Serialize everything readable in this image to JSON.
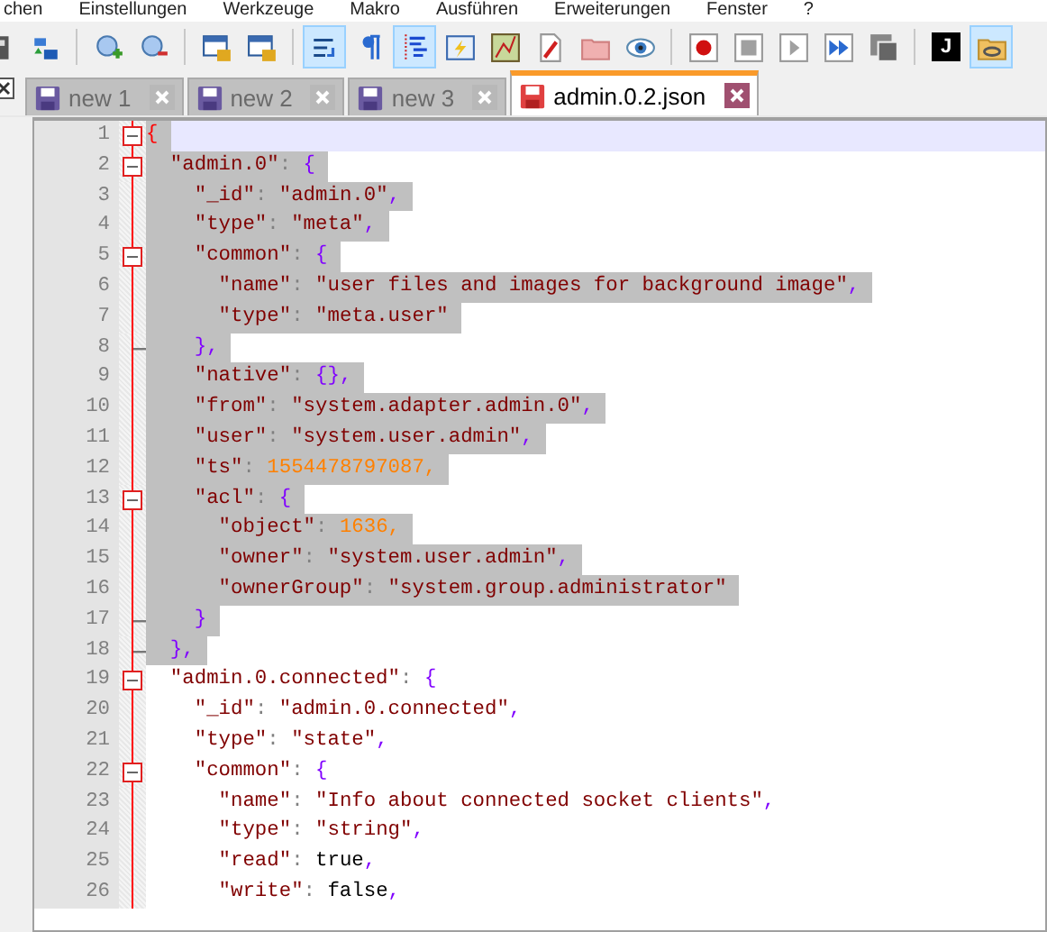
{
  "menu": [
    "chen",
    "Einstellungen",
    "Werkzeuge",
    "Makro",
    "Ausführen",
    "Erweiterungen",
    "Fenster",
    "?"
  ],
  "toolbar": {
    "groups": [
      [
        {
          "pressed": false
        },
        {
          "pressed": false
        }
      ],
      [
        {
          "pressed": false
        },
        {
          "pressed": false
        }
      ],
      [
        {
          "pressed": false
        },
        {
          "pressed": false
        }
      ],
      [
        {
          "pressed": true
        },
        {
          "pressed": false
        },
        {
          "pressed": true
        },
        {
          "pressed": false
        },
        {
          "pressed": false
        },
        {
          "pressed": false
        },
        {
          "pressed": false
        },
        {
          "pressed": false
        }
      ],
      [
        {
          "pressed": false
        },
        {
          "pressed": false
        },
        {
          "pressed": false
        },
        {
          "pressed": false
        },
        {
          "pressed": false
        }
      ],
      [
        {
          "pressed": false,
          "label": "J"
        },
        {
          "pressed": true
        }
      ]
    ]
  },
  "tabs": [
    {
      "label": "new 1",
      "selected": false,
      "saved": true
    },
    {
      "label": "new 2",
      "selected": false,
      "saved": true
    },
    {
      "label": "new 3",
      "selected": false,
      "saved": true
    },
    {
      "label": "admin.0.2.json",
      "selected": true,
      "saved": false
    }
  ],
  "editor": {
    "lines": [
      {
        "number": "1",
        "selected": true,
        "current": true,
        "kind": "start",
        "tokens": [
          {
            "t": "{",
            "kind": "match"
          }
        ]
      },
      {
        "number": "2",
        "selected": true,
        "current": false,
        "kind": "start",
        "tokens": [
          {
            "t": "  \"admin.0\"",
            "kind": "str"
          },
          {
            "t": ": ",
            "kind": "colon"
          },
          {
            "t": "{",
            "kind": "op"
          }
        ]
      },
      {
        "number": "3",
        "selected": true,
        "current": false,
        "kind": "plain",
        "tokens": [
          {
            "t": "    \"_id\"",
            "kind": "str"
          },
          {
            "t": ": ",
            "kind": "colon"
          },
          {
            "t": "\"admin.0\"",
            "kind": "str"
          },
          {
            "t": ",",
            "kind": "op"
          }
        ]
      },
      {
        "number": "4",
        "selected": true,
        "current": false,
        "kind": "plain",
        "tokens": [
          {
            "t": "    \"type\"",
            "kind": "str"
          },
          {
            "t": ": ",
            "kind": "colon"
          },
          {
            "t": "\"meta\"",
            "kind": "str"
          },
          {
            "t": ",",
            "kind": "op"
          }
        ]
      },
      {
        "number": "5",
        "selected": true,
        "current": false,
        "kind": "start",
        "tokens": [
          {
            "t": "    \"common\"",
            "kind": "str"
          },
          {
            "t": ": ",
            "kind": "colon"
          },
          {
            "t": "{",
            "kind": "op"
          }
        ]
      },
      {
        "number": "6",
        "selected": true,
        "current": false,
        "kind": "plain",
        "tokens": [
          {
            "t": "      \"name\"",
            "kind": "str"
          },
          {
            "t": ": ",
            "kind": "colon"
          },
          {
            "t": "\"user files and images for background image\"",
            "kind": "str"
          },
          {
            "t": ",",
            "kind": "op"
          }
        ]
      },
      {
        "number": "7",
        "selected": true,
        "current": false,
        "kind": "plain",
        "tokens": [
          {
            "t": "      \"type\"",
            "kind": "str"
          },
          {
            "t": ": ",
            "kind": "colon"
          },
          {
            "t": "\"meta.user\"",
            "kind": "str"
          }
        ]
      },
      {
        "number": "8",
        "selected": true,
        "current": false,
        "kind": "end",
        "tokens": [
          {
            "t": "    },",
            "kind": "op"
          }
        ]
      },
      {
        "number": "9",
        "selected": true,
        "current": false,
        "kind": "plain",
        "tokens": [
          {
            "t": "    \"native\"",
            "kind": "str"
          },
          {
            "t": ": ",
            "kind": "colon"
          },
          {
            "t": "{},",
            "kind": "op"
          }
        ]
      },
      {
        "number": "10",
        "selected": true,
        "current": false,
        "kind": "plain",
        "tokens": [
          {
            "t": "    \"from\"",
            "kind": "str"
          },
          {
            "t": ": ",
            "kind": "colon"
          },
          {
            "t": "\"system.adapter.admin.0\"",
            "kind": "str"
          },
          {
            "t": ",",
            "kind": "op"
          }
        ]
      },
      {
        "number": "11",
        "selected": true,
        "current": false,
        "kind": "plain",
        "tokens": [
          {
            "t": "    \"user\"",
            "kind": "str"
          },
          {
            "t": ": ",
            "kind": "colon"
          },
          {
            "t": "\"system.user.admin\"",
            "kind": "str"
          },
          {
            "t": ",",
            "kind": "op"
          }
        ]
      },
      {
        "number": "12",
        "selected": true,
        "current": false,
        "kind": "plain",
        "tokens": [
          {
            "t": "    \"ts\"",
            "kind": "str"
          },
          {
            "t": ": ",
            "kind": "colon"
          },
          {
            "t": "1554478797087,",
            "kind": "num"
          }
        ]
      },
      {
        "number": "13",
        "selected": true,
        "current": false,
        "kind": "start",
        "tokens": [
          {
            "t": "    \"acl\"",
            "kind": "str"
          },
          {
            "t": ": ",
            "kind": "colon"
          },
          {
            "t": "{",
            "kind": "op"
          }
        ]
      },
      {
        "number": "14",
        "selected": true,
        "current": false,
        "kind": "plain",
        "tokens": [
          {
            "t": "      \"object\"",
            "kind": "str"
          },
          {
            "t": ": ",
            "kind": "colon"
          },
          {
            "t": "1636,",
            "kind": "num"
          }
        ]
      },
      {
        "number": "15",
        "selected": true,
        "current": false,
        "kind": "plain",
        "tokens": [
          {
            "t": "      \"owner\"",
            "kind": "str"
          },
          {
            "t": ": ",
            "kind": "colon"
          },
          {
            "t": "\"system.user.admin\"",
            "kind": "str"
          },
          {
            "t": ",",
            "kind": "op"
          }
        ]
      },
      {
        "number": "16",
        "selected": true,
        "current": false,
        "kind": "plain",
        "tokens": [
          {
            "t": "      \"ownerGroup\"",
            "kind": "str"
          },
          {
            "t": ": ",
            "kind": "colon"
          },
          {
            "t": "\"system.group.administrator\"",
            "kind": "str"
          }
        ]
      },
      {
        "number": "17",
        "selected": true,
        "current": false,
        "kind": "end",
        "tokens": [
          {
            "t": "    }",
            "kind": "op"
          }
        ]
      },
      {
        "number": "18",
        "selected": true,
        "current": false,
        "kind": "end",
        "tokens": [
          {
            "t": "  },",
            "kind": "op"
          }
        ]
      },
      {
        "number": "19",
        "selected": false,
        "current": false,
        "kind": "start",
        "tokens": [
          {
            "t": "  \"admin.0.connected\"",
            "kind": "str"
          },
          {
            "t": ": ",
            "kind": "colon"
          },
          {
            "t": "{",
            "kind": "op"
          }
        ]
      },
      {
        "number": "20",
        "selected": false,
        "current": false,
        "kind": "plain",
        "tokens": [
          {
            "t": "    \"_id\"",
            "kind": "str"
          },
          {
            "t": ": ",
            "kind": "colon"
          },
          {
            "t": "\"admin.0.connected\"",
            "kind": "str"
          },
          {
            "t": ",",
            "kind": "op"
          }
        ]
      },
      {
        "number": "21",
        "selected": false,
        "current": false,
        "kind": "plain",
        "tokens": [
          {
            "t": "    \"type\"",
            "kind": "str"
          },
          {
            "t": ": ",
            "kind": "colon"
          },
          {
            "t": "\"state\"",
            "kind": "str"
          },
          {
            "t": ",",
            "kind": "op"
          }
        ]
      },
      {
        "number": "22",
        "selected": false,
        "current": false,
        "kind": "start",
        "tokens": [
          {
            "t": "    \"common\"",
            "kind": "str"
          },
          {
            "t": ": ",
            "kind": "colon"
          },
          {
            "t": "{",
            "kind": "op"
          }
        ]
      },
      {
        "number": "23",
        "selected": false,
        "current": false,
        "kind": "plain",
        "tokens": [
          {
            "t": "      \"name\"",
            "kind": "str"
          },
          {
            "t": ": ",
            "kind": "colon"
          },
          {
            "t": "\"Info about connected socket clients\"",
            "kind": "str"
          },
          {
            "t": ",",
            "kind": "op"
          }
        ]
      },
      {
        "number": "24",
        "selected": false,
        "current": false,
        "kind": "plain",
        "tokens": [
          {
            "t": "      \"type\"",
            "kind": "str"
          },
          {
            "t": ": ",
            "kind": "colon"
          },
          {
            "t": "\"string\"",
            "kind": "str"
          },
          {
            "t": ",",
            "kind": "op"
          }
        ]
      },
      {
        "number": "25",
        "selected": false,
        "current": false,
        "kind": "plain",
        "tokens": [
          {
            "t": "      \"read\"",
            "kind": "str"
          },
          {
            "t": ": ",
            "kind": "colon"
          },
          {
            "t": "true",
            "kind": "lit"
          },
          {
            "t": ",",
            "kind": "op"
          }
        ]
      },
      {
        "number": "26",
        "selected": false,
        "current": false,
        "kind": "plain",
        "tokens": [
          {
            "t": "      \"write\"",
            "kind": "str"
          },
          {
            "t": ": ",
            "kind": "colon"
          },
          {
            "t": "false",
            "kind": "lit"
          },
          {
            "t": ",",
            "kind": "op"
          }
        ]
      }
    ]
  }
}
